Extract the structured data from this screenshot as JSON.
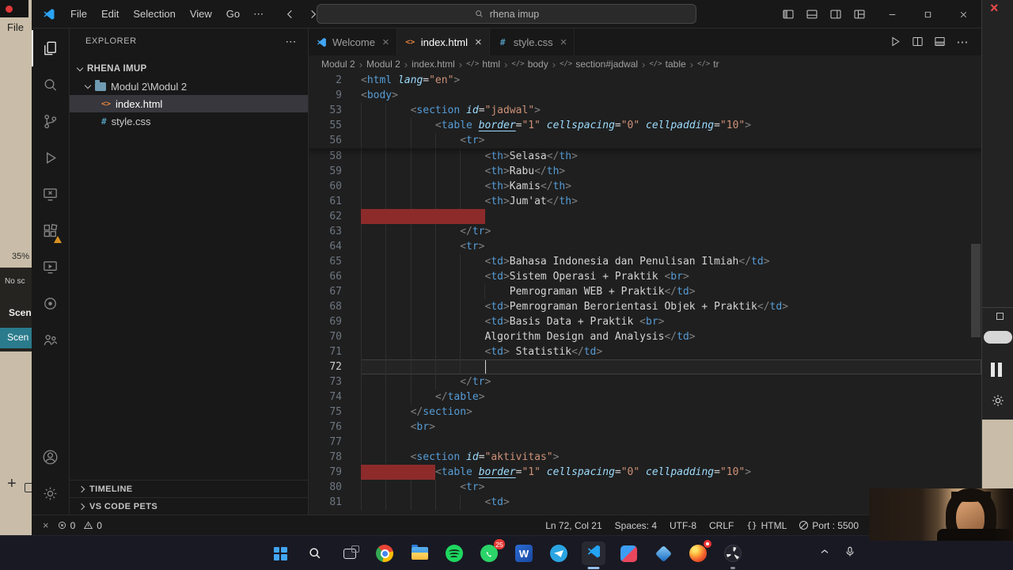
{
  "glyphs": {
    "close": "×",
    "more": "⋯",
    "sep": "›",
    "tag_icon": "</>",
    "html_file": "<>",
    "css_file": "#",
    "braces": "{}",
    "word": "W",
    "plus": "+"
  },
  "obs": {
    "menu": "File",
    "zoom": "35%",
    "no_source": "No sc",
    "scenes": "Scene",
    "scene": "Scen",
    "add": "+"
  },
  "titlebar": {
    "menus": [
      "File",
      "Edit",
      "Selection",
      "View",
      "Go"
    ],
    "overflow": "⋯",
    "search": "rhena imup"
  },
  "tabs": [
    {
      "label": "Welcome"
    },
    {
      "label": "index.html",
      "active": true
    },
    {
      "label": "style.css"
    }
  ],
  "breadcrumbs": [
    {
      "label": "Modul 2"
    },
    {
      "label": "Modul 2"
    },
    {
      "label": "index.html"
    },
    {
      "label": "html",
      "tag": true
    },
    {
      "label": "body",
      "tag": true
    },
    {
      "label": "section#jadwal",
      "tag": true
    },
    {
      "label": "table",
      "tag": true
    },
    {
      "label": "tr",
      "tag": true
    }
  ],
  "explorer": {
    "header": "EXPLORER",
    "root": "RHENA IMUP",
    "folder": "Modul 2\\Modul 2",
    "files": [
      {
        "name": "index.html",
        "selected": true
      },
      {
        "name": "style.css"
      }
    ],
    "panels": [
      "TIMELINE",
      "VS CODE PETS"
    ]
  },
  "activity": {
    "items": [
      "explorer",
      "search",
      "source-control",
      "run-debug",
      "remote-explorer",
      "extensions",
      "live-preview",
      "record",
      "organization"
    ],
    "active": "explorer",
    "badged": "extensions"
  },
  "code": {
    "sticky": [
      {
        "n": 2,
        "i": 0,
        "k": [
          [
            "p",
            "<"
          ],
          [
            "t",
            "html"
          ],
          [
            "x",
            " "
          ],
          [
            "a",
            "lang"
          ],
          [
            "x",
            "="
          ],
          [
            "s",
            "\"en\""
          ],
          [
            "p",
            ">"
          ]
        ]
      },
      {
        "n": 9,
        "i": 0,
        "k": [
          [
            "p",
            "<"
          ],
          [
            "t",
            "body"
          ],
          [
            "p",
            ">"
          ]
        ]
      },
      {
        "n": 53,
        "i": 8,
        "k": [
          [
            "p",
            "<"
          ],
          [
            "t",
            "section"
          ],
          [
            "x",
            " "
          ],
          [
            "a",
            "id"
          ],
          [
            "x",
            "="
          ],
          [
            "s",
            "\"jadwal\""
          ],
          [
            "p",
            ">"
          ]
        ]
      },
      {
        "n": 55,
        "i": 12,
        "k": [
          [
            "p",
            "<"
          ],
          [
            "t",
            "table"
          ],
          [
            "x",
            " "
          ],
          [
            "u",
            "border"
          ],
          [
            "x",
            "="
          ],
          [
            "s",
            "\"1\""
          ],
          [
            "x",
            " "
          ],
          [
            "a",
            "cellspacing"
          ],
          [
            "x",
            "="
          ],
          [
            "s",
            "\"0\""
          ],
          [
            "x",
            " "
          ],
          [
            "a",
            "cellpadding"
          ],
          [
            "x",
            "="
          ],
          [
            "s",
            "\"10\""
          ],
          [
            "p",
            ">"
          ]
        ]
      },
      {
        "n": 56,
        "i": 16,
        "k": [
          [
            "p",
            "<"
          ],
          [
            "t",
            "tr"
          ],
          [
            "p",
            ">"
          ]
        ]
      }
    ],
    "lines": [
      {
        "n": 58,
        "i": 20,
        "k": [
          [
            "p",
            "<"
          ],
          [
            "t",
            "th"
          ],
          [
            "p",
            ">"
          ],
          [
            "x",
            "Selasa"
          ],
          [
            "p",
            "</"
          ],
          [
            "t",
            "th"
          ],
          [
            "p",
            ">"
          ]
        ]
      },
      {
        "n": 59,
        "i": 20,
        "k": [
          [
            "p",
            "<"
          ],
          [
            "t",
            "th"
          ],
          [
            "p",
            ">"
          ],
          [
            "x",
            "Rabu"
          ],
          [
            "p",
            "</"
          ],
          [
            "t",
            "th"
          ],
          [
            "p",
            ">"
          ]
        ]
      },
      {
        "n": 60,
        "i": 20,
        "k": [
          [
            "p",
            "<"
          ],
          [
            "t",
            "th"
          ],
          [
            "p",
            ">"
          ],
          [
            "x",
            "Kamis"
          ],
          [
            "p",
            "</"
          ],
          [
            "t",
            "th"
          ],
          [
            "p",
            ">"
          ]
        ]
      },
      {
        "n": 61,
        "i": 20,
        "k": [
          [
            "p",
            "<"
          ],
          [
            "t",
            "th"
          ],
          [
            "p",
            ">"
          ],
          [
            "x",
            "Jum'at"
          ],
          [
            "p",
            "</"
          ],
          [
            "t",
            "th"
          ],
          [
            "p",
            ">"
          ]
        ]
      },
      {
        "n": 62,
        "i": 20,
        "red": 20,
        "k": []
      },
      {
        "n": 63,
        "i": 16,
        "k": [
          [
            "p",
            "</"
          ],
          [
            "t",
            "tr"
          ],
          [
            "p",
            ">"
          ]
        ]
      },
      {
        "n": 64,
        "i": 16,
        "k": [
          [
            "p",
            "<"
          ],
          [
            "t",
            "tr"
          ],
          [
            "p",
            ">"
          ]
        ]
      },
      {
        "n": 65,
        "i": 20,
        "k": [
          [
            "p",
            "<"
          ],
          [
            "t",
            "td"
          ],
          [
            "p",
            ">"
          ],
          [
            "x",
            "Bahasa Indonesia dan Penulisan Ilmiah"
          ],
          [
            "p",
            "</"
          ],
          [
            "t",
            "td"
          ],
          [
            "p",
            ">"
          ]
        ]
      },
      {
        "n": 66,
        "i": 20,
        "k": [
          [
            "p",
            "<"
          ],
          [
            "t",
            "td"
          ],
          [
            "p",
            ">"
          ],
          [
            "x",
            "Sistem Operasi + Praktik "
          ],
          [
            "p",
            "<"
          ],
          [
            "t",
            "br"
          ],
          [
            "p",
            ">"
          ]
        ]
      },
      {
        "n": 67,
        "i": 24,
        "k": [
          [
            "x",
            "Pemrograman WEB + Praktik"
          ],
          [
            "p",
            "</"
          ],
          [
            "t",
            "td"
          ],
          [
            "p",
            ">"
          ]
        ]
      },
      {
        "n": 68,
        "i": 20,
        "k": [
          [
            "p",
            "<"
          ],
          [
            "t",
            "td"
          ],
          [
            "p",
            ">"
          ],
          [
            "x",
            "Pemrograman Berorientasi Objek + Praktik"
          ],
          [
            "p",
            "</"
          ],
          [
            "t",
            "td"
          ],
          [
            "p",
            ">"
          ]
        ]
      },
      {
        "n": 69,
        "i": 20,
        "k": [
          [
            "p",
            "<"
          ],
          [
            "t",
            "td"
          ],
          [
            "p",
            ">"
          ],
          [
            "x",
            "Basis Data + Praktik "
          ],
          [
            "p",
            "<"
          ],
          [
            "t",
            "br"
          ],
          [
            "p",
            ">"
          ]
        ]
      },
      {
        "n": 70,
        "i": 20,
        "k": [
          [
            "x",
            "Algorithm Design and Analysis"
          ],
          [
            "p",
            "</"
          ],
          [
            "t",
            "td"
          ],
          [
            "p",
            ">"
          ]
        ]
      },
      {
        "n": 71,
        "i": 20,
        "k": [
          [
            "p",
            "<"
          ],
          [
            "t",
            "td"
          ],
          [
            "p",
            ">"
          ],
          [
            "x",
            " Statistik"
          ],
          [
            "p",
            "</"
          ],
          [
            "t",
            "td"
          ],
          [
            "p",
            ">"
          ]
        ]
      },
      {
        "n": 72,
        "i": 20,
        "cur": true,
        "caret": 20,
        "k": []
      },
      {
        "n": 73,
        "i": 16,
        "k": [
          [
            "p",
            "</"
          ],
          [
            "t",
            "tr"
          ],
          [
            "p",
            ">"
          ]
        ]
      },
      {
        "n": 74,
        "i": 12,
        "k": [
          [
            "p",
            "</"
          ],
          [
            "t",
            "table"
          ],
          [
            "p",
            ">"
          ]
        ]
      },
      {
        "n": 75,
        "i": 8,
        "k": [
          [
            "p",
            "</"
          ],
          [
            "t",
            "section"
          ],
          [
            "p",
            ">"
          ]
        ]
      },
      {
        "n": 76,
        "i": 8,
        "k": [
          [
            "p",
            "<"
          ],
          [
            "t",
            "br"
          ],
          [
            "p",
            ">"
          ]
        ]
      },
      {
        "n": 77,
        "i": 8,
        "k": []
      },
      {
        "n": 78,
        "i": 8,
        "k": [
          [
            "p",
            "<"
          ],
          [
            "t",
            "section"
          ],
          [
            "x",
            " "
          ],
          [
            "a",
            "id"
          ],
          [
            "x",
            "="
          ],
          [
            "s",
            "\"aktivitas\""
          ],
          [
            "p",
            ">"
          ]
        ]
      },
      {
        "n": 79,
        "i": 12,
        "red": 12,
        "k": [
          [
            "p",
            "<"
          ],
          [
            "t",
            "table"
          ],
          [
            "x",
            " "
          ],
          [
            "u",
            "border"
          ],
          [
            "x",
            "="
          ],
          [
            "s",
            "\"1\""
          ],
          [
            "x",
            " "
          ],
          [
            "a",
            "cellspacing"
          ],
          [
            "x",
            "="
          ],
          [
            "s",
            "\"0\""
          ],
          [
            "x",
            " "
          ],
          [
            "a",
            "cellpadding"
          ],
          [
            "x",
            "="
          ],
          [
            "s",
            "\"10\""
          ],
          [
            "p",
            ">"
          ]
        ]
      },
      {
        "n": 80,
        "i": 16,
        "k": [
          [
            "p",
            "<"
          ],
          [
            "t",
            "tr"
          ],
          [
            "p",
            ">"
          ]
        ]
      },
      {
        "n": 81,
        "i": 20,
        "k": [
          [
            "p",
            "<"
          ],
          [
            "t",
            "td"
          ],
          [
            "p",
            ">"
          ]
        ]
      }
    ]
  },
  "statusbar": {
    "errors": "0",
    "warnings": "0",
    "items": [
      {
        "text": "Ln 72, Col 21"
      },
      {
        "text": "Spaces: 4"
      },
      {
        "text": "UTF-8"
      },
      {
        "text": "CRLF"
      },
      {
        "text": "HTML",
        "icon": "lang"
      },
      {
        "text": "Port : 5500",
        "icon": "port"
      }
    ]
  },
  "taskbar": {
    "apps": [
      "start",
      "search",
      "task-view",
      "chrome",
      "file-explorer",
      "spotify",
      "whatsapp",
      "word",
      "telegram",
      "vscode",
      "photos",
      "drive",
      "firefox",
      "obs"
    ],
    "whatsapp_badge": "25"
  },
  "colors": {
    "accent_blue": "#0078d4",
    "editor_bg": "#1f1f1f",
    "panel_bg": "#181818",
    "tag_blue": "#569cd6",
    "attr_blue": "#9cdcfe",
    "string_orange": "#ce9178",
    "punct_gray": "#808080",
    "text_gray": "#d4d4d4",
    "red_decoration": "#8d2b2b",
    "selection_teal": "#2a7b8c",
    "obs_beige": "#c9bda9",
    "taskbar_bg": "#191923"
  }
}
